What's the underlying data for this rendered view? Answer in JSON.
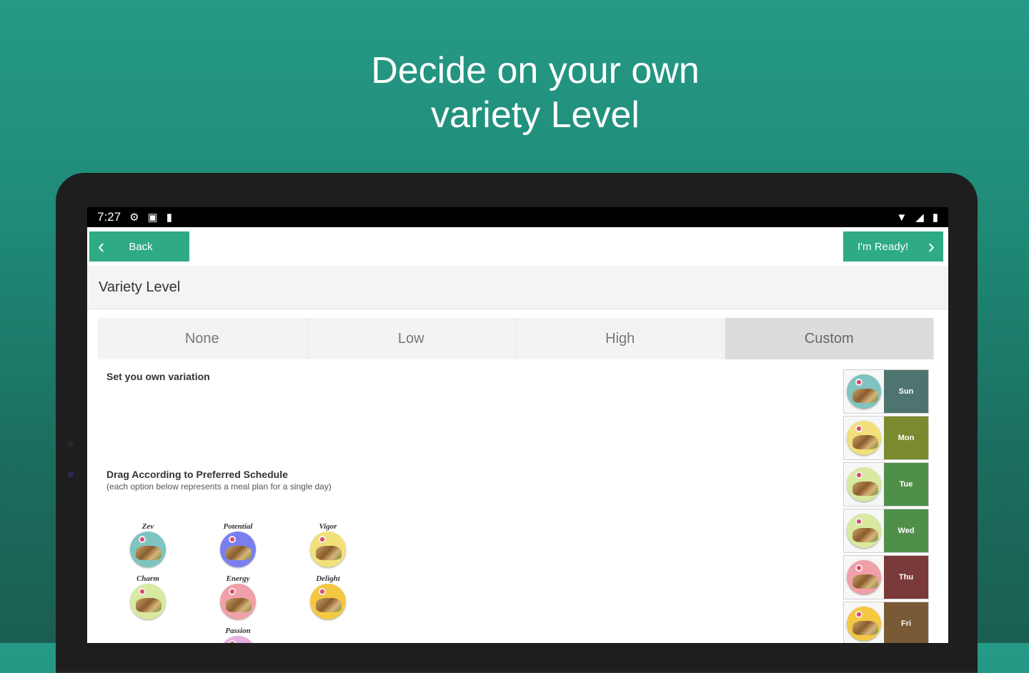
{
  "headline": {
    "line1": "Decide on your own",
    "line2": "variety Level"
  },
  "status_bar": {
    "time": "7:27",
    "left_icons": [
      "gear-icon",
      "square-notification-icon",
      "sd-card-icon"
    ],
    "right_icons": [
      "wifi-icon",
      "signal-icon",
      "battery-icon"
    ]
  },
  "toolbar": {
    "back_label": "Back",
    "ready_label": "I'm Ready!"
  },
  "section": {
    "title": "Variety Level"
  },
  "variety_options": [
    {
      "label": "None",
      "selected": false
    },
    {
      "label": "Low",
      "selected": false
    },
    {
      "label": "High",
      "selected": false
    },
    {
      "label": "Custom",
      "selected": true
    }
  ],
  "custom": {
    "set_label": "Set you own variation",
    "drag_label": "Drag According to Preferred Schedule",
    "drag_sub": "(each option below represents a meal plan for a single day)"
  },
  "meal_plans": [
    {
      "name": "Zev",
      "color": "#7fc4c0"
    },
    {
      "name": "Potential",
      "color": "#7a7ff0"
    },
    {
      "name": "Vigor",
      "color": "#f2e07a"
    },
    {
      "name": "Charm",
      "color": "#d7eaa0"
    },
    {
      "name": "Energy",
      "color": "#f0a0a8"
    },
    {
      "name": "Delight",
      "color": "#f5c842"
    },
    {
      "name": "Passion",
      "color": "#e8b0e0"
    }
  ],
  "schedule": [
    {
      "day": "Sun",
      "plan_color": "#7fc4c0",
      "bg": "#4e7470"
    },
    {
      "day": "Mon",
      "plan_color": "#f2e07a",
      "bg": "#7a8a2e"
    },
    {
      "day": "Tue",
      "plan_color": "#d7eaa0",
      "bg": "#4f8f4a"
    },
    {
      "day": "Wed",
      "plan_color": "#d7eaa0",
      "bg": "#4f8f4a"
    },
    {
      "day": "Thu",
      "plan_color": "#f0a0a8",
      "bg": "#7a3a3a"
    },
    {
      "day": "Fri",
      "plan_color": "#f5c842",
      "bg": "#7a5a36"
    }
  ]
}
